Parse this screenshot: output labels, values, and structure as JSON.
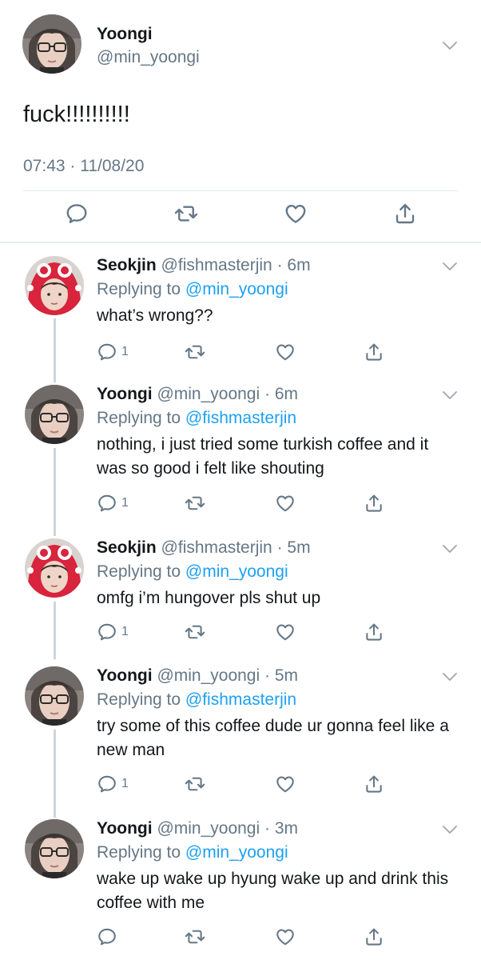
{
  "main_tweet": {
    "author_name": "Yoongi",
    "author_handle": "@min_yoongi",
    "text": "fuck!!!!!!!!!!",
    "timestamp": "07:43 · 11/08/20"
  },
  "replies": [
    {
      "author_name": "Seokjin",
      "meta": "@fishmasterjin · 6m",
      "replying_prefix": "Replying to ",
      "replying_to": "@min_yoongi",
      "text": "what’s wrong??",
      "reply_count": "1",
      "avatar": "red-hat-avatar"
    },
    {
      "author_name": "Yoongi",
      "meta": "@min_yoongi · 6m",
      "replying_prefix": "Replying to ",
      "replying_to": "@fishmasterjin",
      "text": "nothing, i just tried some turkish coffee and it was so good i felt like shouting",
      "reply_count": "1",
      "avatar": "glasses-avatar"
    },
    {
      "author_name": "Seokjin",
      "meta": "@fishmasterjin · 5m",
      "replying_prefix": "Replying to ",
      "replying_to": "@min_yoongi",
      "text": "omfg i’m hungover pls shut up",
      "reply_count": "1",
      "avatar": "red-hat-avatar"
    },
    {
      "author_name": "Yoongi",
      "meta": "@min_yoongi · 5m",
      "replying_prefix": "Replying to ",
      "replying_to": "@fishmasterjin",
      "text": "try some of this coffee dude ur gonna feel like a new man",
      "reply_count": "1",
      "avatar": "glasses-avatar"
    },
    {
      "author_name": "Yoongi",
      "meta": "@min_yoongi · 3m",
      "replying_prefix": "Replying to ",
      "replying_to": "@min_yoongi",
      "text": "wake up wake up hyung wake up and drink this coffee with me",
      "reply_count": "",
      "avatar": "glasses-avatar"
    }
  ],
  "colors": {
    "text": "#14171a",
    "secondary": "#657786",
    "link": "#1da1f2",
    "divider": "#e1e8ed",
    "thread_line": "#ccd6dd"
  },
  "icons": [
    "chevron-down-icon",
    "reply-icon",
    "retweet-icon",
    "like-icon",
    "share-icon"
  ]
}
